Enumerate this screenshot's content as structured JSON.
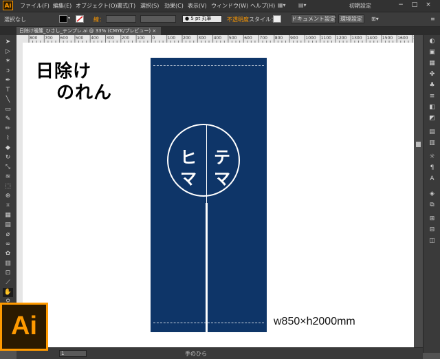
{
  "app": {
    "logo": "Ai",
    "workspace": "初期設定"
  },
  "menu": [
    "ファイル(F)",
    "編集(E)",
    "オブジェクト(O)",
    "書式(T)",
    "選択(S)",
    "効果(C)",
    "表示(V)",
    "ウィンドウ(W)",
    "ヘルプ(H)"
  ],
  "window_controls": {
    "minimize": "−",
    "maximize": "□",
    "close": "×"
  },
  "control_bar": {
    "selection": "選択なし",
    "stroke_label": "線：",
    "brush": "5 pt 丸筆",
    "opacity": "不透明度",
    "style": "スタイル：",
    "document_setup": "ドキュメント設定",
    "preferences": "環境設定"
  },
  "tab": {
    "title": "日除け暖簾_ひさし_テンプレ.ai @ 33% (CMYK/プレビュー)"
  },
  "ruler_marks": [
    "800",
    "700",
    "600",
    "500",
    "400",
    "300",
    "200",
    "100",
    "0",
    "100",
    "200",
    "300",
    "400",
    "500",
    "600",
    "700",
    "800",
    "900",
    "1000",
    "1100",
    "1200",
    "1300",
    "1400",
    "1500",
    "1600",
    "1700"
  ],
  "status": {
    "zoom": "1",
    "tool": "手のひら"
  },
  "artwork": {
    "title_line1": "日除け",
    "title_line2": "のれん",
    "kamon_chars": [
      "テ",
      "マ",
      "ヒ",
      "マ"
    ],
    "size_label": "w850×h2000mm",
    "fabric_color": "#0e3568"
  },
  "colors": {
    "accent": "#ff9a00",
    "ui_dark": "#323232",
    "ui_mid": "#535353"
  },
  "icons": [
    "selection-tool",
    "direct-selection-tool",
    "magic-wand-tool",
    "lasso-tool",
    "pen-tool",
    "type-tool",
    "line-tool",
    "rectangle-tool",
    "paintbrush-tool",
    "pencil-tool",
    "blob-brush-tool",
    "eraser-tool",
    "rotate-tool",
    "scale-tool",
    "width-tool",
    "free-transform-tool",
    "shape-builder-tool",
    "perspective-tool",
    "mesh-tool",
    "gradient-tool",
    "eyedropper-tool",
    "blend-tool",
    "symbol-sprayer-tool",
    "graph-tool",
    "artboard-tool",
    "slice-tool",
    "hand-tool",
    "zoom-tool"
  ]
}
